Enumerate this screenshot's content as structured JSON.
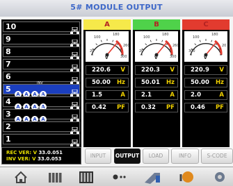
{
  "title": "5# MODULE OUTPUT",
  "modules": [
    {
      "num": "10",
      "active": false,
      "dots": []
    },
    {
      "num": "9",
      "active": false,
      "dots": []
    },
    {
      "num": "8",
      "active": false,
      "dots": []
    },
    {
      "num": "7",
      "active": false,
      "dots": []
    },
    {
      "num": "6",
      "active": false,
      "dots": []
    },
    {
      "num": "5",
      "active": true,
      "dots": [
        "A",
        "A",
        "A",
        "A"
      ],
      "tag": "INV"
    },
    {
      "num": "4",
      "active": false,
      "dots": [
        "A",
        "A",
        "A",
        "A"
      ],
      "tag": "INV"
    },
    {
      "num": "3",
      "active": false,
      "dots": [
        "A",
        "A",
        "A",
        "A"
      ],
      "tag": "INV"
    },
    {
      "num": "2",
      "active": false,
      "dots": []
    },
    {
      "num": "1",
      "active": false,
      "dots": []
    }
  ],
  "phases": [
    {
      "label": "A",
      "color": "#f6e94a",
      "gauge": {
        "ticks": [
          "100",
          "180",
          "260",
          "20",
          "300"
        ],
        "unit": "V",
        "value": 220.6
      },
      "voltage": "220.6",
      "voltage_unit": "V",
      "freq": "50.00",
      "freq_unit": "Hz",
      "current": "1.5",
      "current_unit": "A",
      "pf": "0.42",
      "pf_unit": "PF"
    },
    {
      "label": "B",
      "color": "#4fd24a",
      "gauge": {
        "ticks": [
          "100",
          "180",
          "260",
          "20",
          "300"
        ],
        "unit": "V",
        "value": 220.3
      },
      "voltage": "220.3",
      "voltage_unit": "V",
      "freq": "50.01",
      "freq_unit": "Hz",
      "current": "2.1",
      "current_unit": "A",
      "pf": "0.32",
      "pf_unit": "PF"
    },
    {
      "label": "C",
      "color": "#e23b2f",
      "gauge": {
        "ticks": [
          "100",
          "180",
          "20",
          "300"
        ],
        "unit": "V",
        "value": 220.9
      },
      "voltage": "220.9",
      "voltage_unit": "V",
      "freq": "50.00",
      "freq_unit": "Hz",
      "current": "2.0",
      "current_unit": "A",
      "pf": "0.46",
      "pf_unit": "PF"
    }
  ],
  "version": {
    "rec_label": "REC VER: V",
    "rec_value": "33.0.051",
    "inv_label": "INV VER: V",
    "inv_value": "33.0.053"
  },
  "tabs": [
    "INPUT",
    "OUTPUT",
    "LOAD",
    "INFO",
    "S-CODE"
  ],
  "selected_tab": "OUTPUT",
  "nav_icons": [
    "home-icon",
    "bars-icon",
    "grid-icon",
    "flow-icon",
    "tools-icon",
    "warning-icon",
    "settings-icon"
  ]
}
